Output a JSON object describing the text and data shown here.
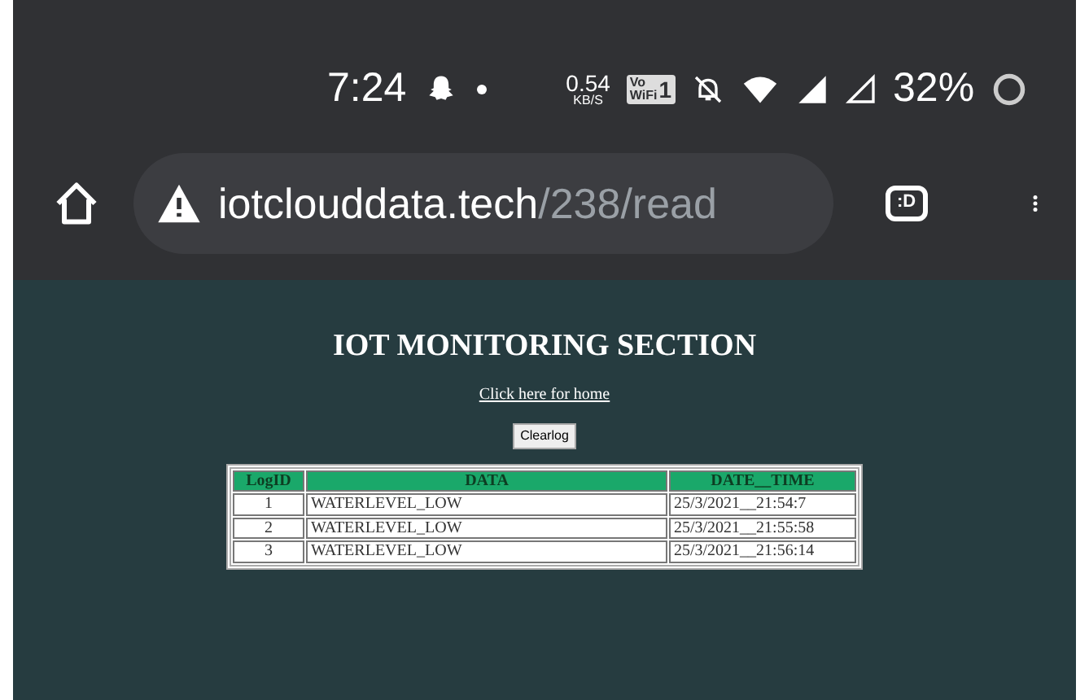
{
  "status_bar": {
    "time": "7:24",
    "speed": "0.54",
    "speed_unit": "KB/S",
    "vowifi_top": "Vo",
    "vowifi_bottom": "WiFi",
    "vowifi_sim": "1",
    "battery": "32%"
  },
  "address_bar": {
    "host": "iotclouddata.tech",
    "path": "/238/read",
    "tab_badge": ":D"
  },
  "page": {
    "title": "IOT MONITORING SECTION",
    "home_link": "Click here for home",
    "clear_button": "Clearlog",
    "table": {
      "columns": [
        "LogID",
        "DATA",
        "DATE__TIME"
      ],
      "rows": [
        [
          "1",
          "WATERLEVEL_LOW",
          "25/3/2021__21:54:7"
        ],
        [
          "2",
          "WATERLEVEL_LOW",
          "25/3/2021__21:55:58"
        ],
        [
          "3",
          "WATERLEVEL_LOW",
          "25/3/2021__21:56:14"
        ]
      ]
    }
  }
}
